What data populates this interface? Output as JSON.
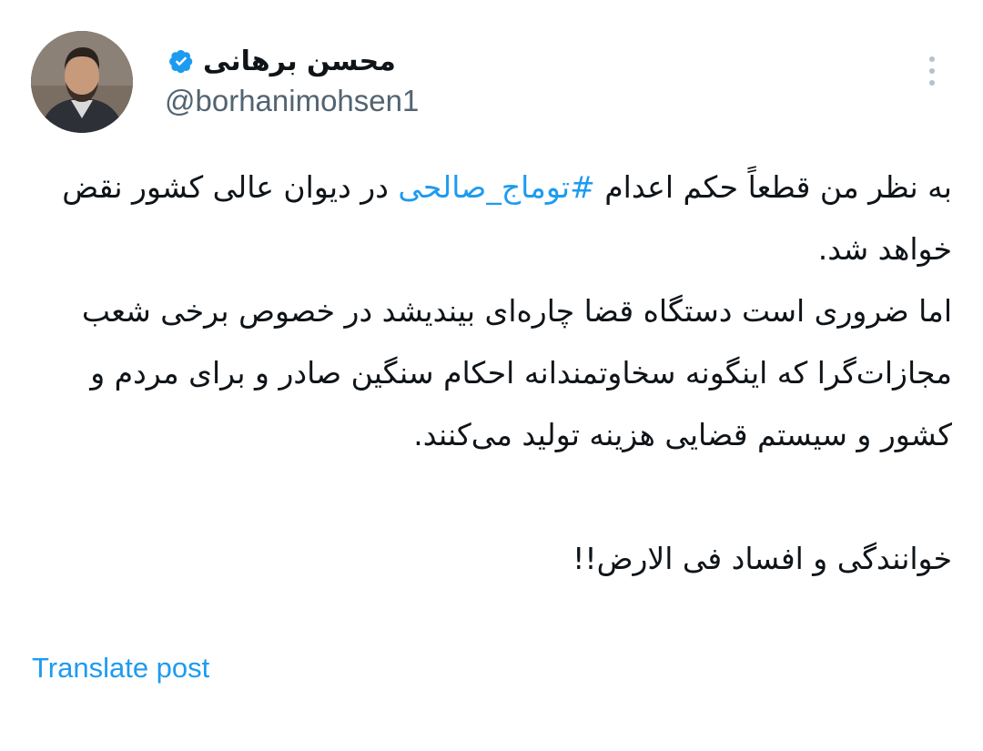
{
  "author": {
    "display_name": "محسن برهانی",
    "handle": "@borhanimohsen1",
    "verified_icon": "verified-badge-icon",
    "avatar": "profile-photo"
  },
  "post": {
    "line1_prefix": "به نظر من قطعاً حکم اعدام ",
    "hashtag": "#توماج_صالحی",
    "line1_suffix": " در دیوان عالی کشور نقض خواهد شد.",
    "paragraph2": "اما ضروری است دستگاه قضا چاره‌ای بیندیشد در خصوص برخی شعب مجازات‌گرا که اینگونه سخاوتمندانه احکام سنگین صادر و برای مردم و کشور و سیستم قضایی هزینه تولید می‌کنند.",
    "paragraph3": "خوانندگی و افساد فی الارض!!"
  },
  "actions": {
    "translate_label": "Translate post",
    "more_icon": "more-vertical-icon"
  },
  "colors": {
    "link": "#1d9bf0",
    "text": "#0f1419",
    "muted": "#536471"
  }
}
